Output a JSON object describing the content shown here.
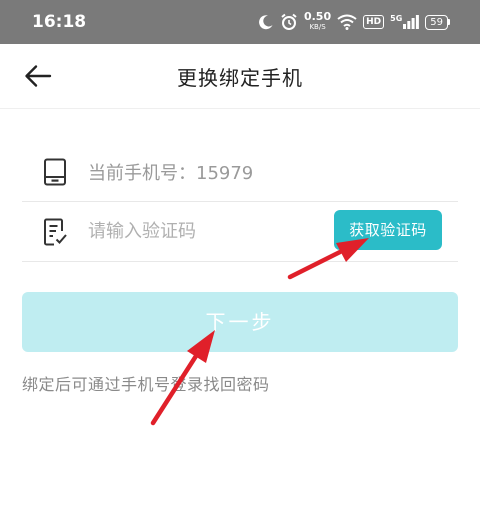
{
  "status_bar": {
    "time": "16:18",
    "net_speed_value": "0.50",
    "net_speed_unit": "KB/S",
    "hd_label": "HD",
    "signal_label": "5G",
    "battery": "59",
    "icons": [
      "moon-icon",
      "alarm-icon",
      "wifi-icon",
      "signal-icon",
      "battery-icon"
    ]
  },
  "header": {
    "title": "更换绑定手机",
    "back_icon": "back-arrow-icon"
  },
  "form": {
    "phone_label": "当前手机号：",
    "phone_value": "15979",
    "code_placeholder": "请输入验证码",
    "code_value": "",
    "get_code_button": "获取验证码"
  },
  "next_button": "下一步",
  "hint": "绑定后可通过手机号登录找回密码",
  "colors": {
    "accent": "#2bbcc8",
    "next_disabled": "#bfedf1",
    "status_bar": "#7a7a7a",
    "annotation_arrow": "#e0202a"
  }
}
